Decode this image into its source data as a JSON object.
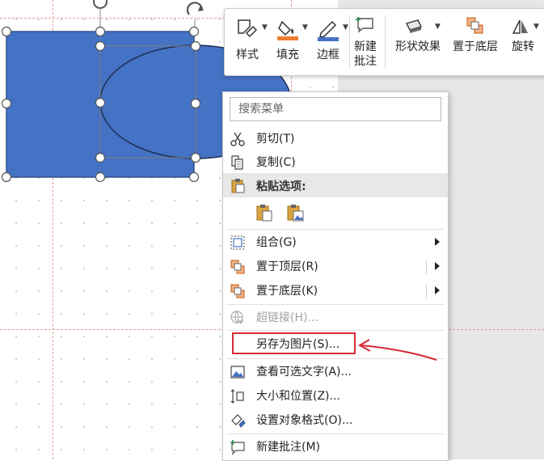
{
  "toolbar": {
    "style_label": "样式",
    "fill_label": "填充",
    "border_label": "边框",
    "new_comment_line1": "新建",
    "new_comment_line2": "批注",
    "shape_effects_label": "形状效果",
    "send_to_back_label": "置于底层",
    "rotate_label": "旋转"
  },
  "menu": {
    "search_placeholder": "搜索菜单",
    "cut": "剪切(T)",
    "copy": "复制(C)",
    "paste_options": "粘贴选项:",
    "group": "组合(G)",
    "bring_to_front": "置于顶层(R)",
    "send_to_back": "置于底层(K)",
    "hyperlink": "超链接(H)...",
    "save_as_picture": "另存为图片(S)...",
    "view_alt_text": "查看可选文字(A)...",
    "size_position": "大小和位置(Z)...",
    "format_object": "设置对象格式(O)...",
    "new_comment": "新建批注(M)"
  },
  "colors": {
    "shape_fill": "#4472c4",
    "fill_accent": "#ed7d31",
    "border_accent": "#4472c4",
    "annotation_red": "#d62b36"
  },
  "icons": {
    "cut": "scissors-icon",
    "copy": "copy-icon",
    "paste": "clipboard-icon",
    "group": "group-icon",
    "bring_front": "bring-to-front-icon",
    "send_back": "send-to-back-icon",
    "hyperlink": "link-icon",
    "alt_text": "image-text-icon",
    "size": "size-icon",
    "format": "format-icon",
    "comment": "comment-icon"
  }
}
